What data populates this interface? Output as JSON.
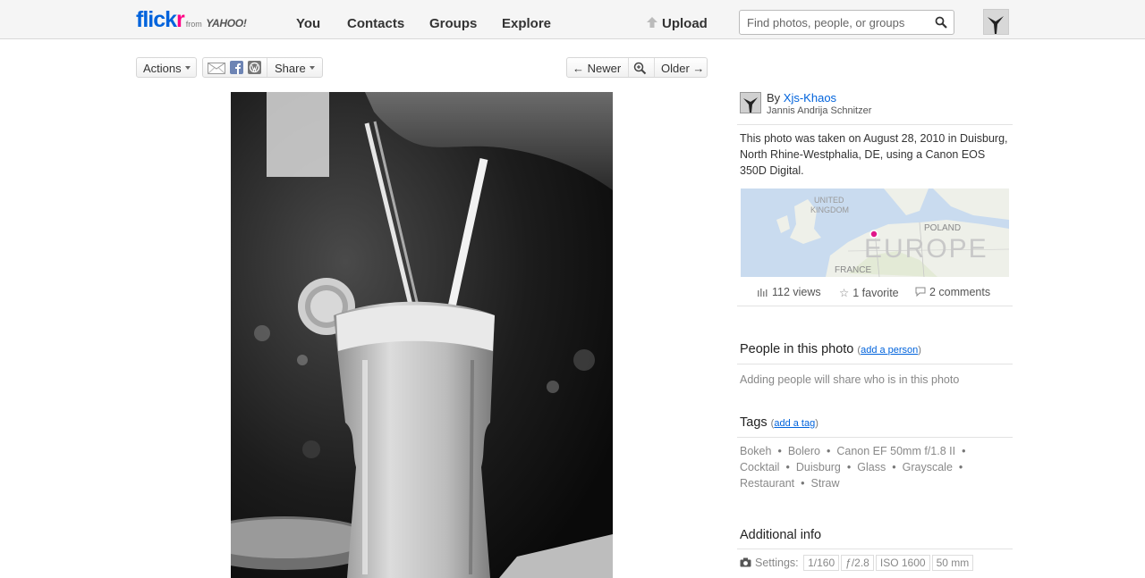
{
  "header": {
    "logo_flick": "flick",
    "logo_r": "r",
    "logo_from": "from",
    "logo_yahoo": "YAHOO!",
    "nav": [
      "You",
      "Contacts",
      "Groups",
      "Explore"
    ],
    "upload": "Upload",
    "search_placeholder": "Find photos, people, or groups"
  },
  "toolbar": {
    "actions": "Actions",
    "share": "Share",
    "newer": "Newer",
    "older": "Older"
  },
  "photo": {
    "alt_icon": "drink-photo"
  },
  "sidebar": {
    "by_prefix": "By",
    "owner": "Xjs-Khaos",
    "real_name": "Jannis Andrija Schnitzer",
    "description": "This photo was taken on August 28, 2010 in Duisburg, North Rhine-Westphalia, DE, using a Canon EOS 350D Digital.",
    "map_labels": {
      "uk": "UNITED\nKINGDOM",
      "poland": "POLAND",
      "europe": "EUROPE",
      "france": "FRANCE"
    },
    "views": "112 views",
    "favorites": "1 favorite",
    "comments": "2 comments",
    "people_title": "People in this photo",
    "people_add": "add a person",
    "people_hint": "Adding people will share who is in this photo",
    "tags_title": "Tags",
    "tags_add": "add a tag",
    "tags": [
      "Bokeh",
      "Bolero",
      "Canon EF 50mm f/1.8 II",
      "Cocktail",
      "Duisburg",
      "Glass",
      "Grayscale",
      "Restaurant",
      "Straw"
    ],
    "additional_title": "Additional info",
    "settings_label": "Settings:",
    "settings": [
      "1/160",
      "ƒ/2.8",
      "ISO 1600",
      "50 mm"
    ]
  },
  "colors": {
    "brand_blue": "#0063dc",
    "brand_pink": "#ff0084",
    "map_pin": "#e0168a"
  }
}
